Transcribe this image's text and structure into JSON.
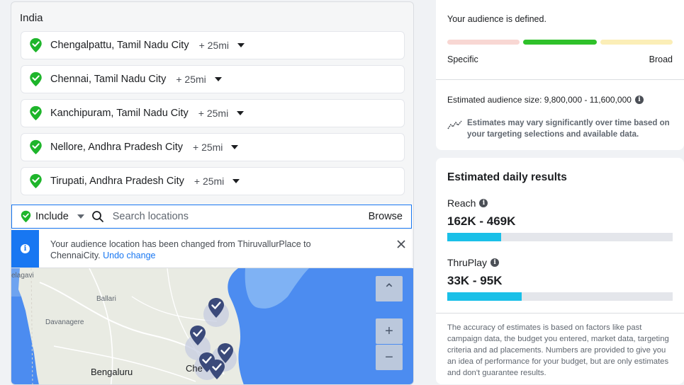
{
  "locations": {
    "country": "India",
    "items": [
      {
        "name": "Chengalpattu, Tamil Nadu City",
        "radius": "+ 25mi"
      },
      {
        "name": "Chennai, Tamil Nadu City",
        "radius": "+ 25mi"
      },
      {
        "name": "Kanchipuram, Tamil Nadu City",
        "radius": "+ 25mi"
      },
      {
        "name": "Nellore, Andhra Pradesh City",
        "radius": "+ 25mi"
      },
      {
        "name": "Tirupati, Andhra Pradesh City",
        "radius": "+ 25mi"
      }
    ]
  },
  "search": {
    "include_label": "Include",
    "placeholder": "Search locations",
    "browse_label": "Browse"
  },
  "notice": {
    "message": "Your audience location has been changed from ThiruvallurPlace to ChennaiCity.",
    "undo_label": "Undo change"
  },
  "map": {
    "labels": [
      "elagavi",
      "Ballari",
      "Davanagere",
      "Bengaluru",
      "Che"
    ],
    "zoom_in": "+",
    "zoom_out": "−",
    "collapse": "⌃"
  },
  "audience": {
    "defined_text": "Your audience is defined.",
    "specific_label": "Specific",
    "broad_label": "Broad",
    "size_label": "Estimated audience size: 9,800,000 - 11,600,000",
    "vary_text": "Estimates may vary significantly over time based on your targeting selections and available data.",
    "colors": {
      "specific": "#f8d7d3",
      "active": "#2fc12a",
      "broad": "#fbeeb7"
    }
  },
  "results": {
    "title": "Estimated daily results",
    "reach": {
      "label": "Reach",
      "value": "162K - 469K",
      "fill_fraction": 0.24
    },
    "thruplay": {
      "label": "ThruPlay",
      "value": "33K - 95K",
      "fill_fraction": 0.33
    },
    "accuracy_text": "The accuracy of estimates is based on factors like past campaign data, the budget you entered, market data, targeting criteria and ad placements. Numbers are provided to give you an idea of performance for your budget, but are only estimates and don't guarantee results.",
    "bar_color": "#1ac0e8"
  }
}
